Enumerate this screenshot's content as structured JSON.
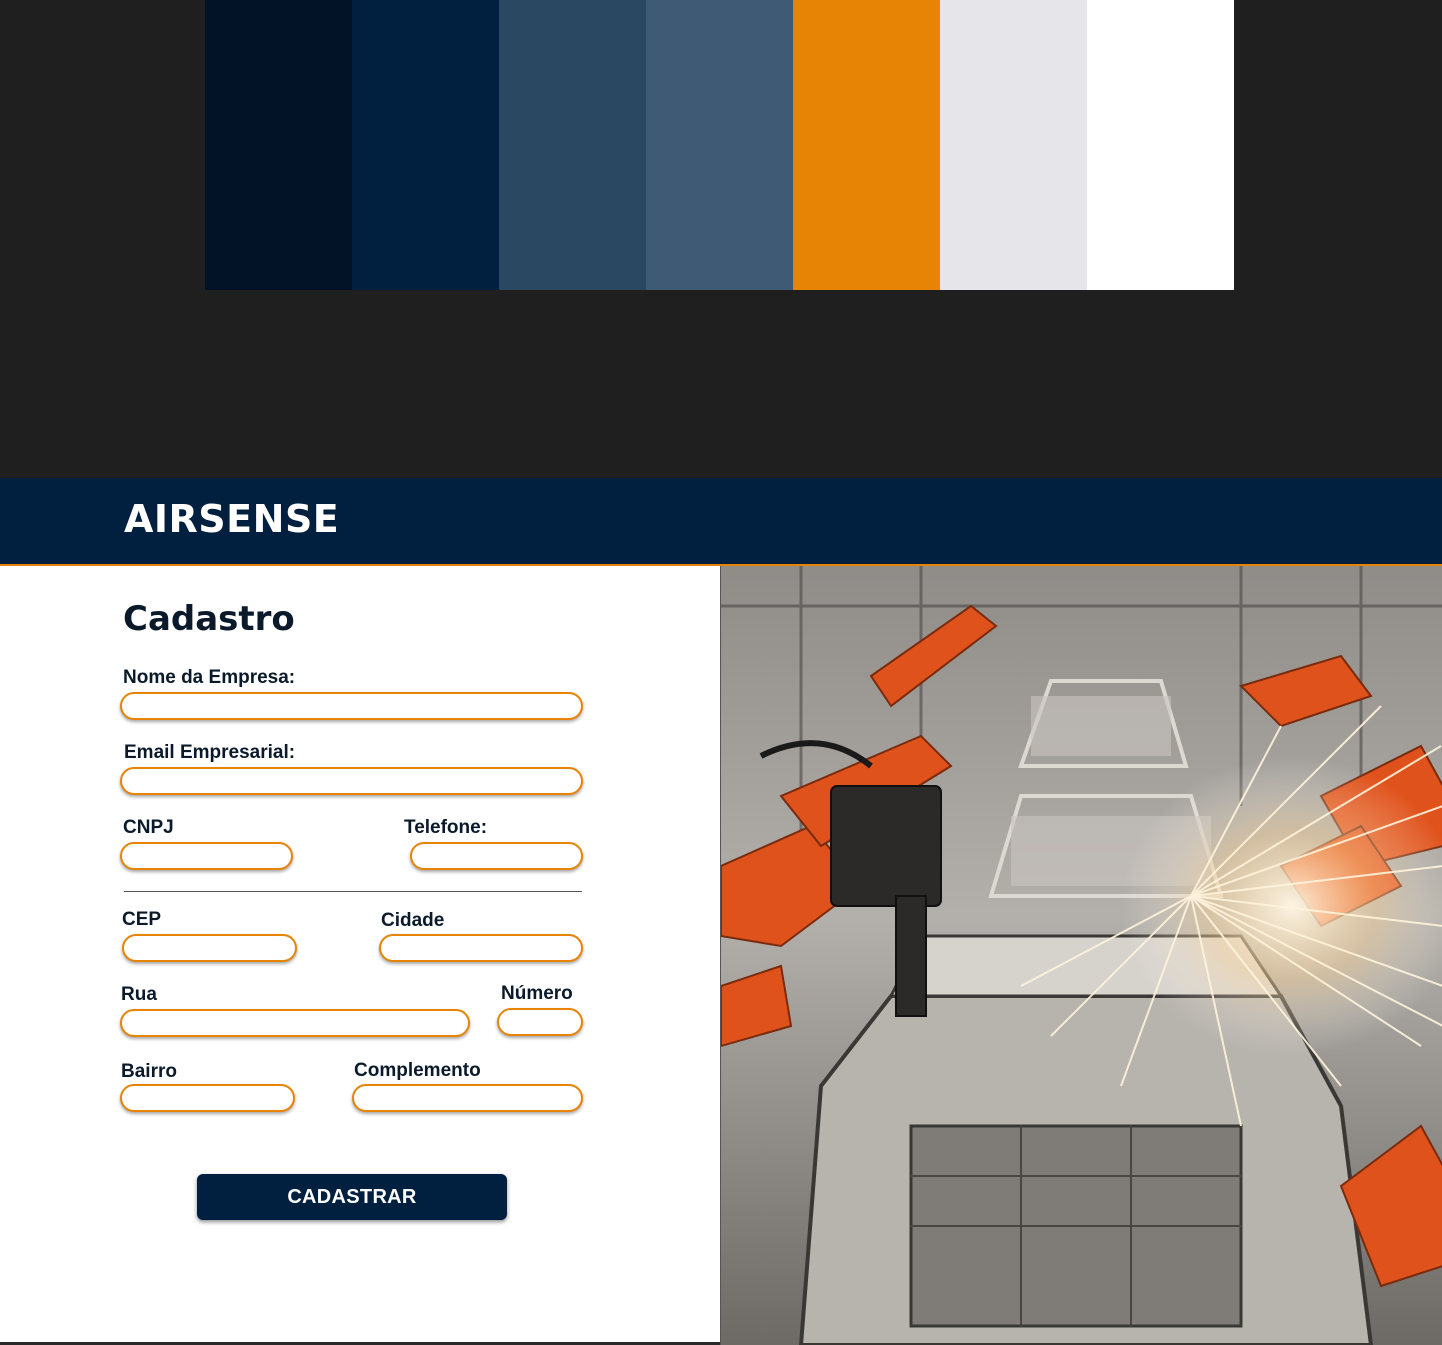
{
  "palette": {
    "colors": [
      "#021327",
      "#01203f",
      "#2b4862",
      "#3e5a74",
      "#e88405",
      "#e6e5ea",
      "#ffffff"
    ]
  },
  "header": {
    "brand": "AIRSENSE",
    "background": "#01203f",
    "accent": "#e88405"
  },
  "form": {
    "title": "Cadastro",
    "fields": {
      "company_name": {
        "label": "Nome da Empresa:",
        "value": ""
      },
      "email": {
        "label": "Email Empresarial:",
        "value": ""
      },
      "cnpj": {
        "label": "CNPJ",
        "value": ""
      },
      "phone": {
        "label": "Telefone:",
        "value": ""
      },
      "cep": {
        "label": "CEP",
        "value": ""
      },
      "city": {
        "label": "Cidade",
        "value": ""
      },
      "street": {
        "label": "Rua",
        "value": ""
      },
      "number": {
        "label": "Número",
        "value": ""
      },
      "district": {
        "label": "Bairro",
        "value": ""
      },
      "complement": {
        "label": "Complemento",
        "value": ""
      }
    },
    "submit_label": "CADASTRAR"
  },
  "image": {
    "subject": "car-factory-robot-arms-welding"
  }
}
